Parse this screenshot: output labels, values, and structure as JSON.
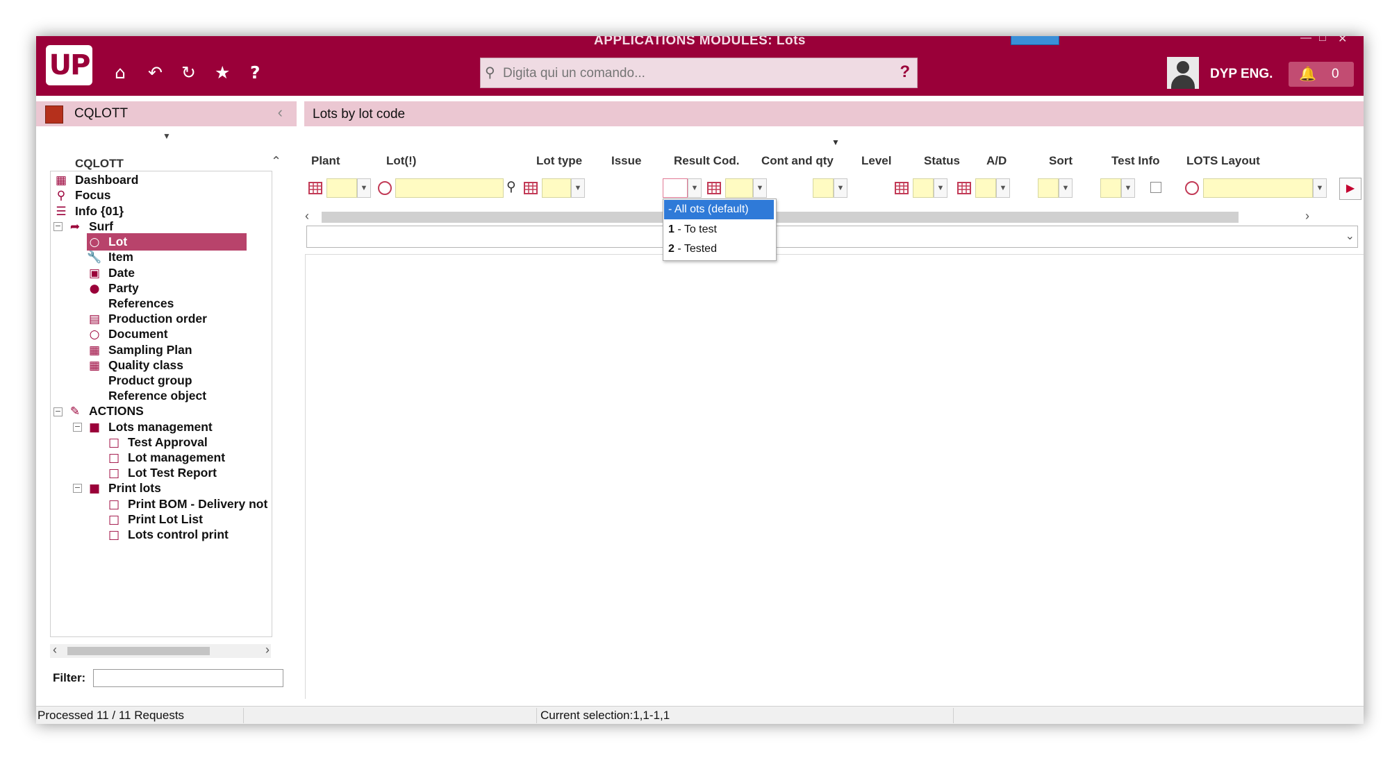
{
  "window": {
    "title": "APPLICATIONS MODULES: Lots",
    "logo_text": "UP"
  },
  "toolbar": {
    "icons": [
      "home-icon",
      "undo-icon",
      "refresh-icon",
      "star-icon",
      "help-icon"
    ],
    "search_placeholder": "Digita qui un comando...",
    "search_help": "?",
    "user_name": "DYP ENG.",
    "notifications_count": "0",
    "colors": {
      "brand": "#9a0039",
      "header_pink": "#ebc7d2",
      "selected": "#b8436b",
      "highlight": "#2f7ad8",
      "input_yellow": "#fffbc2"
    }
  },
  "left_panel": {
    "header": "CQLOTT",
    "tree_title": "CQLOTT",
    "items": [
      {
        "label": "Dashboard",
        "icon": "dashboard-icon"
      },
      {
        "label": "Focus",
        "icon": "search-icon"
      },
      {
        "label": "Info {01}",
        "icon": "list-icon"
      },
      {
        "label": "Surf",
        "icon": "arrow-icon"
      },
      {
        "label": "Lot",
        "icon": "circle-icon"
      },
      {
        "label": "Item",
        "icon": "wrench-icon"
      },
      {
        "label": "Date",
        "icon": "calendar-icon"
      },
      {
        "label": "Party",
        "icon": "person-icon"
      },
      {
        "label": "References",
        "icon": ""
      },
      {
        "label": "Production order",
        "icon": "clipboard-icon"
      },
      {
        "label": "Document",
        "icon": "circle-icon"
      },
      {
        "label": "Sampling Plan",
        "icon": "grid-icon"
      },
      {
        "label": "Quality class",
        "icon": "grid-icon"
      },
      {
        "label": "Product group",
        "icon": ""
      },
      {
        "label": "Reference object",
        "icon": ""
      },
      {
        "label": "ACTIONS",
        "icon": "pencil-icon"
      },
      {
        "label": "Lots management",
        "icon": "folder-icon"
      },
      {
        "label": "Test Approval",
        "icon": "monitor-icon"
      },
      {
        "label": "Lot management",
        "icon": "monitor-icon"
      },
      {
        "label": "Lot Test Report",
        "icon": "monitor-icon"
      },
      {
        "label": "Print lots",
        "icon": "folder-icon"
      },
      {
        "label": "Print BOM - Delivery not",
        "icon": "monitor-icon"
      },
      {
        "label": "Print Lot List",
        "icon": "monitor-icon"
      },
      {
        "label": "Lots control print",
        "icon": "monitor-icon"
      }
    ],
    "filter_label": "Filter:"
  },
  "main": {
    "header": "Lots by lot code",
    "fields": {
      "plant": "Plant",
      "lot": "Lot(!)",
      "lot_type": "Lot type",
      "issue": "Issue",
      "result_cod": "Result Cod.",
      "cont_qty": "Cont and qty",
      "level": "Level",
      "status": "Status",
      "ad": "A/D",
      "sort": "Sort",
      "test_info": "Test Info",
      "lots_layout": "LOTS Layout"
    },
    "issue_options": [
      {
        "code": "",
        "label": "- All ots (default)"
      },
      {
        "code": "1",
        "label": " - To test"
      },
      {
        "code": "2",
        "label": " - Tested"
      }
    ]
  },
  "status": {
    "left": "Processed 11 / 11 Requests",
    "middle": "Current selection:1,1-1,1"
  }
}
